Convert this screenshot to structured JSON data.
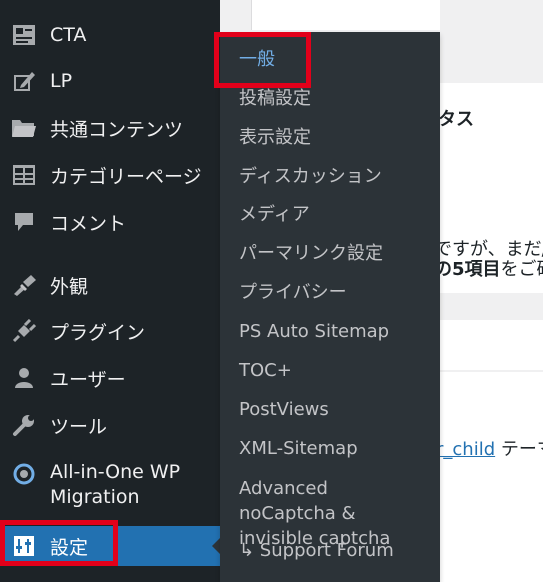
{
  "sidebar": {
    "items": [
      {
        "label": "CTA",
        "icon": "form-icon"
      },
      {
        "label": "LP",
        "icon": "edit-icon"
      },
      {
        "label": "共通コンテンツ",
        "icon": "folder-icon"
      },
      {
        "label": "カテゴリーページ",
        "icon": "table-icon"
      },
      {
        "label": "コメント",
        "icon": "comment-icon"
      },
      {
        "label": "外観",
        "icon": "brush-icon"
      },
      {
        "label": "プラグイン",
        "icon": "plugin-icon"
      },
      {
        "label": "ユーザー",
        "icon": "user-icon"
      },
      {
        "label": "ツール",
        "icon": "wrench-icon"
      },
      {
        "label": "All-in-One WP Migration",
        "icon": "migration-icon"
      },
      {
        "label": "設定",
        "icon": "settings-icon"
      }
    ]
  },
  "submenu": {
    "items": [
      "一般",
      "投稿設定",
      "表示設定",
      "ディスカッション",
      "メディア",
      "パーマリンク設定",
      "プライバシー",
      "PS Auto Sitemap",
      "TOC+",
      "PostViews",
      "XML-Sitemap",
      "Advanced noCaptcha & invisible captcha",
      "↳ Support Forum"
    ]
  },
  "content": {
    "heading_fragment": "タス",
    "text1_fragment": "ですが、まだ/",
    "text2_bold": "の5項目",
    "text2_rest": "をご確",
    "link_fragment": "r_child",
    "text3_rest": " テーマ"
  },
  "colors": {
    "sidebar_bg": "#1d2327",
    "submenu_bg": "#2c3338",
    "accent": "#2271b1",
    "highlight": "#e2001a",
    "submenu_current": "#72aee6"
  }
}
